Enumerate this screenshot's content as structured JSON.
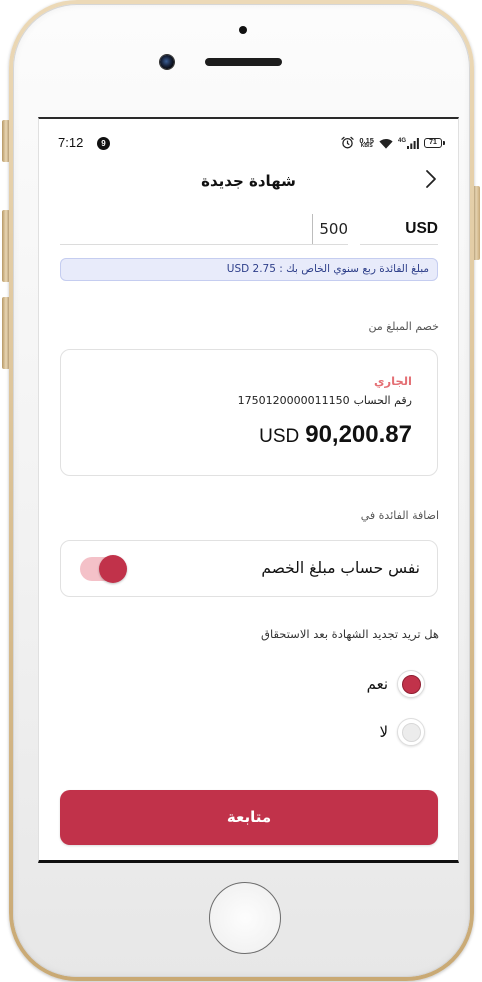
{
  "status_bar": {
    "time": "7:12",
    "notification_badge": "9",
    "net_speed": "0.15",
    "net_speed_unit": "KB/S",
    "network_type": "4G",
    "battery_level": "71"
  },
  "header": {
    "title": "شهادة جديدة"
  },
  "amount_input": {
    "value": "500",
    "currency": "USD"
  },
  "interest_notice": "مبلغ الفائدة ربع سنوي الخاص بك : USD 2.75",
  "debit_from": {
    "label": "خصم المبلغ من",
    "account": {
      "type": "الجاري",
      "number_label": "رقم الحساب",
      "number": "1750120000011150",
      "currency": "USD",
      "balance": "90,200.87"
    }
  },
  "interest_to": {
    "label": "اضافة الفائدة في",
    "option_label": "نفس حساب مبلغ الخصم",
    "toggle_on": true
  },
  "renewal": {
    "question": "هل تريد تجديد الشهادة بعد الاستحقاق",
    "options": [
      {
        "label": "نعم",
        "selected": true
      },
      {
        "label": "لا",
        "selected": false
      }
    ]
  },
  "continue_button": {
    "label": "متابعة"
  },
  "icons": {
    "back": "chevron-right-icon",
    "alarm": "alarm-icon",
    "wifi": "wifi-icon",
    "signal": "signal-icon",
    "battery": "battery-icon",
    "camera": "front-camera-icon",
    "home": "home-button-icon"
  },
  "colors": {
    "accent": "#c1324a",
    "toggle_track": "#f4c1c8",
    "notice_bg": "#e8ebfa",
    "notice_border": "#c5cdf0",
    "notice_text": "#2e3f8a",
    "account_type": "#e46f74"
  }
}
